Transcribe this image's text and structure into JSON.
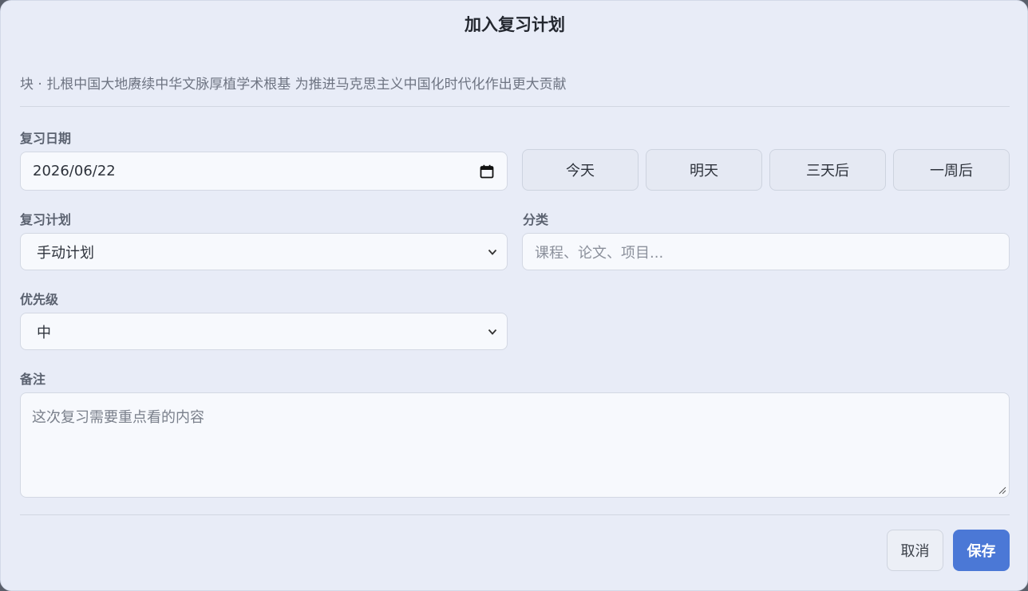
{
  "dialog": {
    "title": "加入复习计划",
    "subtitle": "块 · 扎根中国大地赓续中华文脉厚植学术根基 为推进马克思主义中国化时代化作出更大贡献"
  },
  "review_date": {
    "label": "复习日期",
    "value": "2026/06/22",
    "quick_buttons": [
      "今天",
      "明天",
      "三天后",
      "一周后"
    ]
  },
  "plan": {
    "label": "复习计划",
    "selected": "手动计划"
  },
  "category": {
    "label": "分类",
    "placeholder": "课程、论文、项目..."
  },
  "priority": {
    "label": "优先级",
    "selected": "中"
  },
  "notes": {
    "label": "备注",
    "placeholder": "这次复习需要重点看的内容"
  },
  "footer": {
    "cancel_label": "取消",
    "save_label": "保存"
  },
  "colors": {
    "accent": "#4b78d6",
    "dialog_bg": "#e8ecf7"
  }
}
